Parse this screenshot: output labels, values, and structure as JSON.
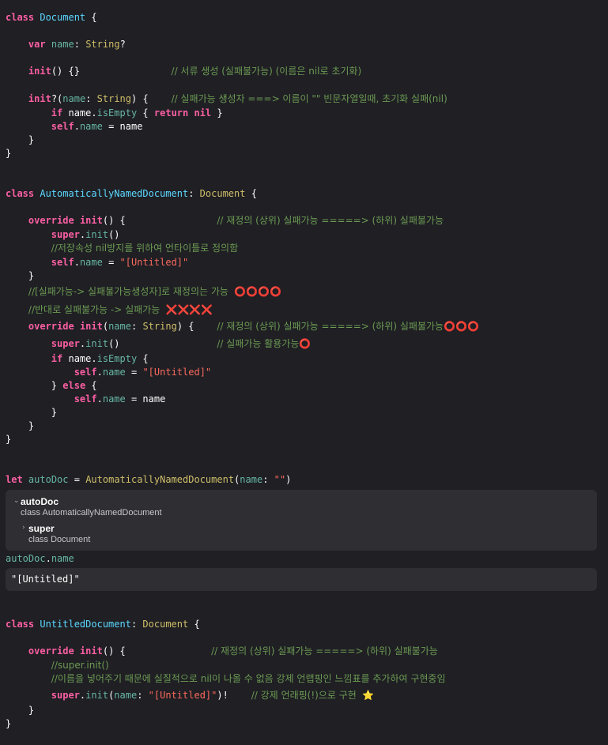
{
  "block1": {
    "l1": [
      "class",
      "Document",
      "{"
    ],
    "l2": [
      "var",
      "name",
      ":",
      "String",
      "?"
    ],
    "l3": [
      "init",
      "() {}",
      "// 서류 생성 (실패불가능) (이름은 nil로 초기화)"
    ],
    "l4": [
      "init",
      "?(",
      "name",
      ":",
      "String",
      ") {",
      "// 실패가능 생성자 ===> 이름이 \"\" 빈문자열일때, 초기화 실패(nil)"
    ],
    "l5": [
      "if",
      "name.",
      "isEmpty",
      "{",
      "return",
      "nil",
      "}"
    ],
    "l6": [
      "self",
      ".",
      "name",
      "= name"
    ],
    "l7": "}",
    "l8": "}"
  },
  "block2": {
    "l1": [
      "class",
      "AutomaticallyNamedDocument",
      ":",
      "Document",
      "{"
    ],
    "l2": [
      "override",
      "init",
      "() {",
      "// 재정의 (상위) 실패가능 =====> (하위) 실패불가능"
    ],
    "l3": [
      "super",
      ".",
      "init",
      "()"
    ],
    "l4": "//저장속성 nil방지를 위하여 언타이틀로 정의함",
    "l5": [
      "self",
      ".",
      "name",
      "=",
      "\"[Untitled]\""
    ],
    "l6": "}",
    "l7": [
      "//[실패가능-> 실패불가능생성자]로 재정의는 가능",
      "⭕⭕⭕⭕"
    ],
    "l8": [
      "//반대로 실패불가능 -> 실패가능",
      "❌❌❌❌"
    ],
    "l9": [
      "override",
      "init",
      "(",
      "name",
      ":",
      "String",
      ") {",
      "// 재정의 (상위) 실패가능 =====> (하위) 실패불가능",
      "⭕⭕⭕"
    ],
    "l10": [
      "super",
      ".",
      "init",
      "()",
      "// 실패가능 활용가능",
      "⭕"
    ],
    "l11": [
      "if",
      "name.",
      "isEmpty",
      "{"
    ],
    "l12": [
      "self",
      ".",
      "name",
      "=",
      "\"[Untitled]\""
    ],
    "l13": [
      "}",
      "else",
      "{"
    ],
    "l14": [
      "self",
      ".",
      "name",
      "= name"
    ],
    "l15": "}",
    "l16": "}",
    "l17": "}"
  },
  "line_let": [
    "let",
    "autoDoc",
    "=",
    "AutomaticallyNamedDocument",
    "(",
    "name",
    ":",
    "\"\"",
    ")"
  ],
  "inspector": {
    "chevron_open": "⌄",
    "chevron_closed": "›",
    "title": "autoDoc",
    "subtitle": "class AutomaticallyNamedDocument",
    "child_title": "super",
    "child_subtitle": "class Document"
  },
  "line_autodoc_name": [
    "autoDoc",
    ".",
    "name"
  ],
  "result_value": "\"[Untitled]\"",
  "block3": {
    "l1": [
      "class",
      "UntitledDocument",
      ":",
      "Document",
      "{"
    ],
    "l2": [
      "override",
      "init",
      "() {",
      "// 재정의 (상위) 실패가능 =====> (하위) 실패불가능"
    ],
    "l3": "//super.init()",
    "l4": "//이름을 넣어주기 때문에 실질적으로 nil이 나올 수 없음 강제 언랩핑인 느낌표를 추가하여 구현중임",
    "l5": [
      "super",
      ".",
      "init",
      "(",
      "name",
      ":",
      "\"[Untitled]\"",
      ")!",
      "// 강제 언래핑(!)으로 구현",
      "⭐"
    ],
    "l6": "}",
    "l7": "}"
  }
}
